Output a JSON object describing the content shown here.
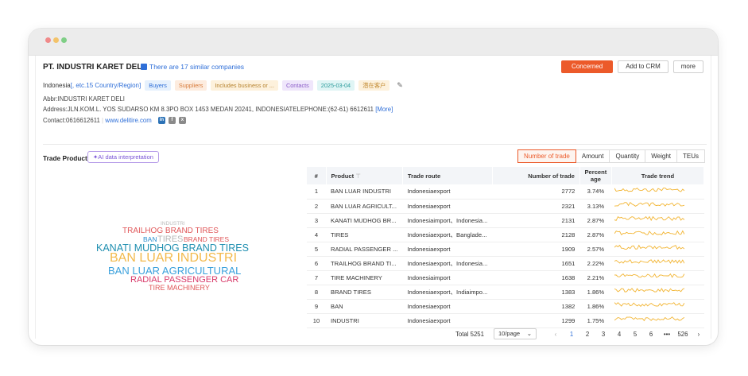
{
  "company": {
    "name": "PT. INDUSTRI KARET DELI",
    "similar_link": "There are 17 similar companies",
    "country": "Indonesia",
    "country_more": "[, etc.15 Country/Region]",
    "tags": [
      "Buyers",
      "Suppliers",
      "Includes business or ...",
      "Contacts",
      "2025-03-04",
      "潜在客户"
    ],
    "abbr": "Abbr:INDUSTRI KARET DELI",
    "address": "Address:JLN.KOM.L. YOS SUDARSO KM 8.3PO BOX 1453 MEDAN 20241, INDONESIATELEPHONE:(62-61) 6612611",
    "address_more": "[More]",
    "contact": "Contact:0616612611",
    "website": "www.delitire.com"
  },
  "actions": {
    "concerned": "Concerned",
    "add_crm": "Add to CRM",
    "more": "more"
  },
  "trade_product": {
    "title": "Trade Product",
    "ai_button": "AI data interpretation",
    "tabs": [
      "Number of trade",
      "Amount",
      "Quantity",
      "Weight",
      "TEUs"
    ],
    "active_tab": "Number of trade",
    "columns": [
      "#",
      "Product",
      "Trade route",
      "Number of trade",
      "Percent age",
      "Trade trend"
    ],
    "rows": [
      {
        "n": "1",
        "product": "BAN LUAR INDUSTRI",
        "route": "Indonesiaexport",
        "count": "2772",
        "pct": "3.74%"
      },
      {
        "n": "2",
        "product": "BAN LUAR AGRICULT...",
        "route": "Indonesiaexport",
        "count": "2321",
        "pct": "3.13%"
      },
      {
        "n": "3",
        "product": "KANATI MUDHOG BR...",
        "route": "Indonesiaimport、Indonesia...",
        "count": "2131",
        "pct": "2.87%"
      },
      {
        "n": "4",
        "product": "TIRES",
        "route": "Indonesiaexport、Banglade...",
        "count": "2128",
        "pct": "2.87%"
      },
      {
        "n": "5",
        "product": "RADIAL PASSENGER ...",
        "route": "Indonesiaexport",
        "count": "1909",
        "pct": "2.57%"
      },
      {
        "n": "6",
        "product": "TRAILHOG BRAND TI...",
        "route": "Indonesiaexport、Indonesia...",
        "count": "1651",
        "pct": "2.22%"
      },
      {
        "n": "7",
        "product": "TIRE MACHINERY",
        "route": "Indonesiaimport",
        "count": "1638",
        "pct": "2.21%"
      },
      {
        "n": "8",
        "product": "BRAND TIRES",
        "route": "Indonesiaexport、Indiaimpo...",
        "count": "1383",
        "pct": "1.86%"
      },
      {
        "n": "9",
        "product": "BAN",
        "route": "Indonesiaexport",
        "count": "1382",
        "pct": "1.86%"
      },
      {
        "n": "10",
        "product": "INDUSTRI",
        "route": "Indonesiaexport",
        "count": "1299",
        "pct": "1.75%"
      }
    ]
  },
  "word_cloud": [
    {
      "text": "INDUSTRI",
      "color": "#bbbbbb"
    },
    {
      "text": "TRAILHOG BRAND TIRES",
      "color": "#e0585a"
    },
    {
      "text": "BAN",
      "color": "#2a8fd0"
    },
    {
      "text": "TIRES",
      "color": "#b9b9b9"
    },
    {
      "text": "BRAND TIRES",
      "color": "#e0585a"
    },
    {
      "text": "KANATI MUDHOG BRAND TIRES",
      "color": "#1f8fb0"
    },
    {
      "text": "BAN LUAR INDUSTRI",
      "color": "#f2b94b"
    },
    {
      "text": "BAN LUAR AGRICULTURAL",
      "color": "#3aa0dc"
    },
    {
      "text": "RADIAL PASSENGER CAR",
      "color": "#d83a6a"
    },
    {
      "text": "TIRE MACHINERY",
      "color": "#e0585a"
    }
  ],
  "pagination": {
    "total": "Total 5251",
    "per_page": "10/page",
    "pages": [
      "1",
      "2",
      "3",
      "4",
      "5",
      "6",
      "•••",
      "526"
    ],
    "current": "1"
  },
  "colors": {
    "accent": "#ec5a2a",
    "link": "#2f6fd8",
    "sparkline": "#f2b431"
  }
}
